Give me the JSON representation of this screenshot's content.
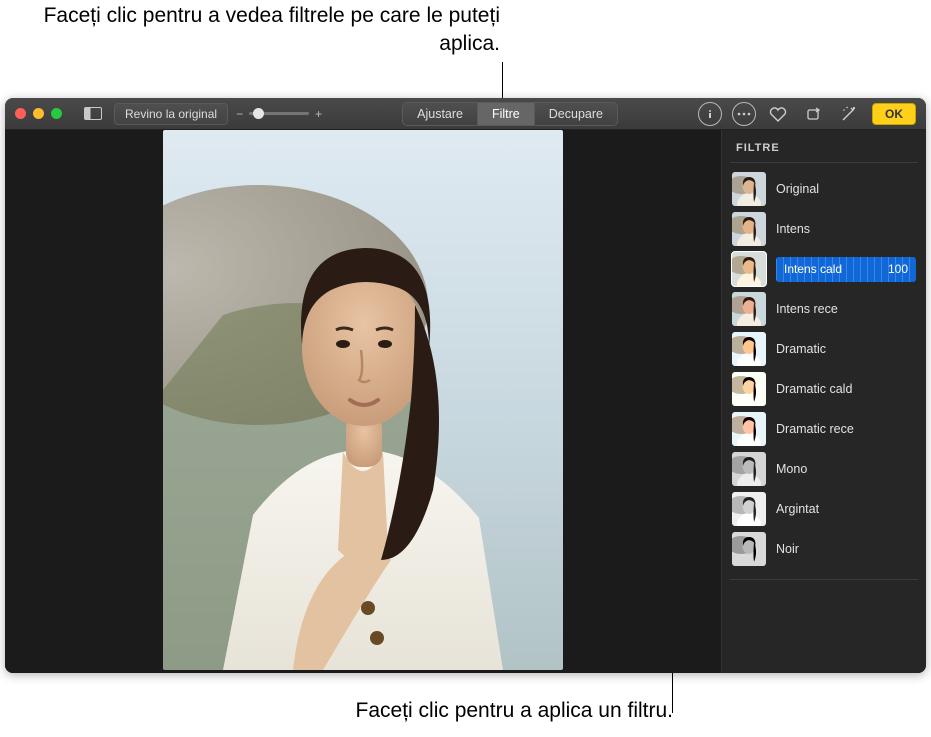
{
  "callouts": {
    "top": "Faceți clic pentru a vedea filtrele pe care le puteți aplica.",
    "bottom": "Faceți clic pentru a aplica un filtru."
  },
  "toolbar": {
    "revert": "Revino la original",
    "segments": {
      "adjust": "Ajustare",
      "filters": "Filtre",
      "crop": "Decupare"
    },
    "ok": "OK"
  },
  "panel": {
    "title": "FILTRE",
    "filters": [
      {
        "label": "Original"
      },
      {
        "label": "Intens"
      },
      {
        "label": "Intens cald",
        "value": "100"
      },
      {
        "label": "Intens rece"
      },
      {
        "label": "Dramatic"
      },
      {
        "label": "Dramatic cald"
      },
      {
        "label": "Dramatic rece"
      },
      {
        "label": "Mono"
      },
      {
        "label": "Argintat"
      },
      {
        "label": "Noir"
      }
    ],
    "selectedIndex": 2
  },
  "colors": {
    "accent": "#1068d8",
    "ok": "#ffcf1a"
  }
}
